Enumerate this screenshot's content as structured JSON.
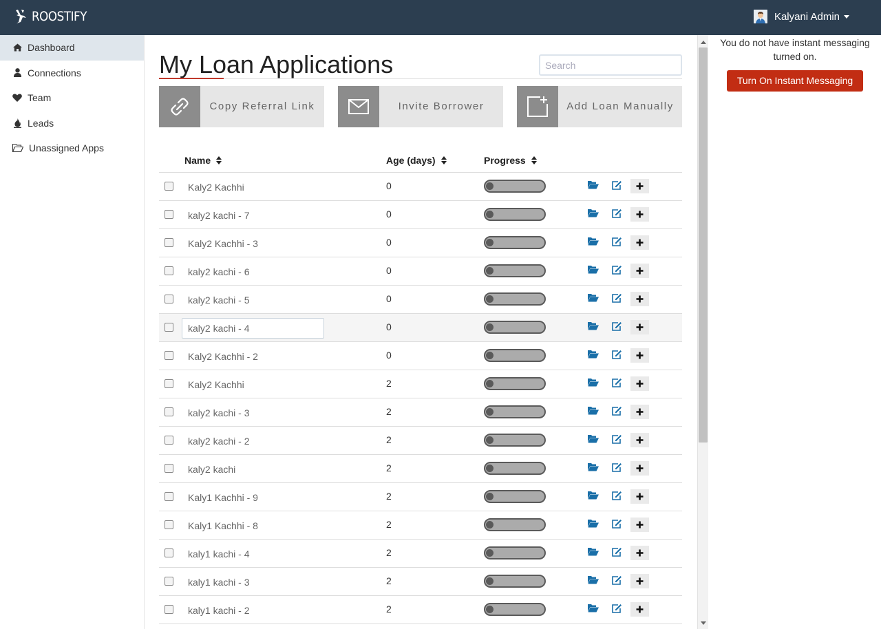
{
  "app": {
    "brand": "ROOSTIFY"
  },
  "user_menu": {
    "name": "Kalyani Admin"
  },
  "sidebar": {
    "items": [
      {
        "label": "Dashboard",
        "icon": "home-icon",
        "active": true
      },
      {
        "label": "Connections",
        "icon": "user-icon",
        "active": false
      },
      {
        "label": "Team",
        "icon": "heart-icon",
        "active": false
      },
      {
        "label": "Leads",
        "icon": "fire-icon",
        "active": false
      },
      {
        "label": "Unassigned Apps",
        "icon": "folder-open-icon",
        "active": false
      }
    ]
  },
  "main": {
    "title": "My Loan Applications",
    "search": {
      "placeholder": "Search",
      "value": ""
    },
    "actions": [
      {
        "label": "Copy Referral Link",
        "icon": "link-icon"
      },
      {
        "label": "Invite Borrower",
        "icon": "envelope-icon"
      },
      {
        "label": "Add Loan Manually",
        "icon": "add-document-icon"
      }
    ],
    "table": {
      "columns": [
        "Name",
        "Age (days)",
        "Progress"
      ],
      "rows": [
        {
          "name": "Kaly2 Kachhi",
          "age": "0",
          "progress": 0
        },
        {
          "name": "kaly2 kachi - 7",
          "age": "0",
          "progress": 0
        },
        {
          "name": "Kaly2 Kachhi - 3",
          "age": "0",
          "progress": 0
        },
        {
          "name": "kaly2 kachi - 6",
          "age": "0",
          "progress": 0
        },
        {
          "name": "kaly2 kachi - 5",
          "age": "0",
          "progress": 0
        },
        {
          "name": "kaly2 kachi - 4",
          "age": "0",
          "progress": 0
        },
        {
          "name": "Kaly2 Kachhi - 2",
          "age": "0",
          "progress": 0
        },
        {
          "name": "Kaly2 Kachhi",
          "age": "2",
          "progress": 0
        },
        {
          "name": "kaly2 kachi - 3",
          "age": "2",
          "progress": 0
        },
        {
          "name": "kaly2 kachi - 2",
          "age": "2",
          "progress": 0
        },
        {
          "name": "kaly2 kachi",
          "age": "2",
          "progress": 0
        },
        {
          "name": "Kaly1 Kachhi - 9",
          "age": "2",
          "progress": 0
        },
        {
          "name": "Kaly1 Kachhi - 8",
          "age": "2",
          "progress": 0
        },
        {
          "name": "kaly1 kachi - 4",
          "age": "2",
          "progress": 0
        },
        {
          "name": "kaly1 kachi - 3",
          "age": "2",
          "progress": 0
        },
        {
          "name": "kaly1 kachi - 2",
          "age": "2",
          "progress": 0
        }
      ],
      "hovered_row_index": 5
    }
  },
  "right_panel": {
    "message": "You do not have instant messaging turned on.",
    "button_label": "Turn On Instant Messaging"
  },
  "colors": {
    "navbar": "#2c3e50",
    "accent_red": "#c22d13",
    "icon_blue": "#1a6fa8"
  }
}
